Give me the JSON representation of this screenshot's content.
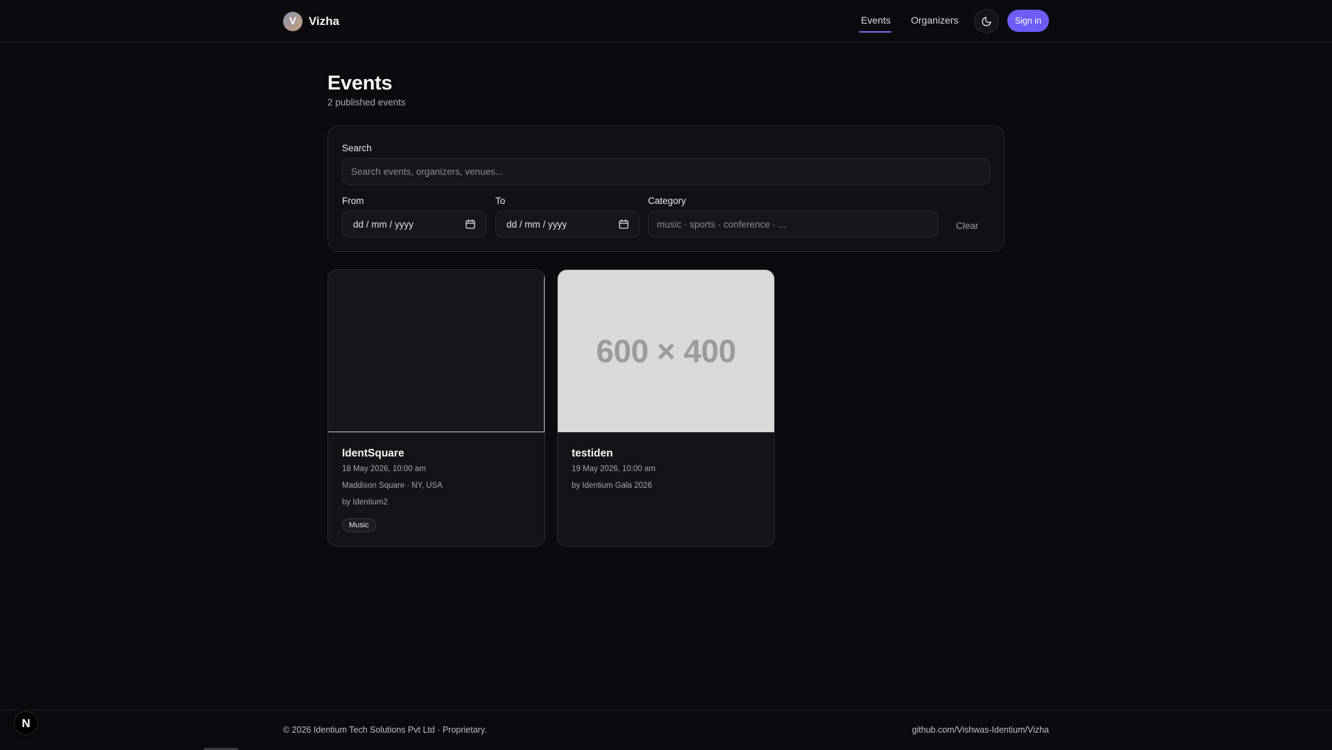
{
  "header": {
    "brand_initial": "V",
    "brand_name": "Vizha",
    "nav": [
      {
        "label": "Events",
        "active": true
      },
      {
        "label": "Organizers",
        "active": false
      }
    ],
    "theme_icon": "moon-icon",
    "signin_label": "Sign in"
  },
  "main": {
    "title": "Events",
    "subtitle": "2 published events"
  },
  "filters": {
    "search_label": "Search",
    "search_placeholder": "Search events, organizers, venues...",
    "from_label": "From",
    "from_value": "dd / mm / yyyy",
    "to_label": "To",
    "to_value": "dd / mm / yyyy",
    "category_label": "Category",
    "category_placeholder": "music · sports · conference · ...",
    "clear_label": "Clear"
  },
  "events": [
    {
      "title": "IdentSquare",
      "date": "18 May 2026, 10:00 am",
      "venue": "Maddison Square · NY, USA",
      "organizer": "by Identium2",
      "tag": "Music"
    },
    {
      "image_text": "600 × 400",
      "title": "testiden",
      "date": "19 May 2026, 10:00 am",
      "organizer": "by Identium Gala 2026"
    }
  ],
  "footer": {
    "copyright": "© 2026 Identium Tech Solutions Pvt Ltd · Proprietary.",
    "repo_link": "github.com/Vishwas-Identium/Vizha"
  },
  "dev_badge": {
    "label": "N"
  },
  "colors": {
    "background": "#0b0b0f",
    "accent": "#6d5cf6",
    "panel": "#111115"
  }
}
